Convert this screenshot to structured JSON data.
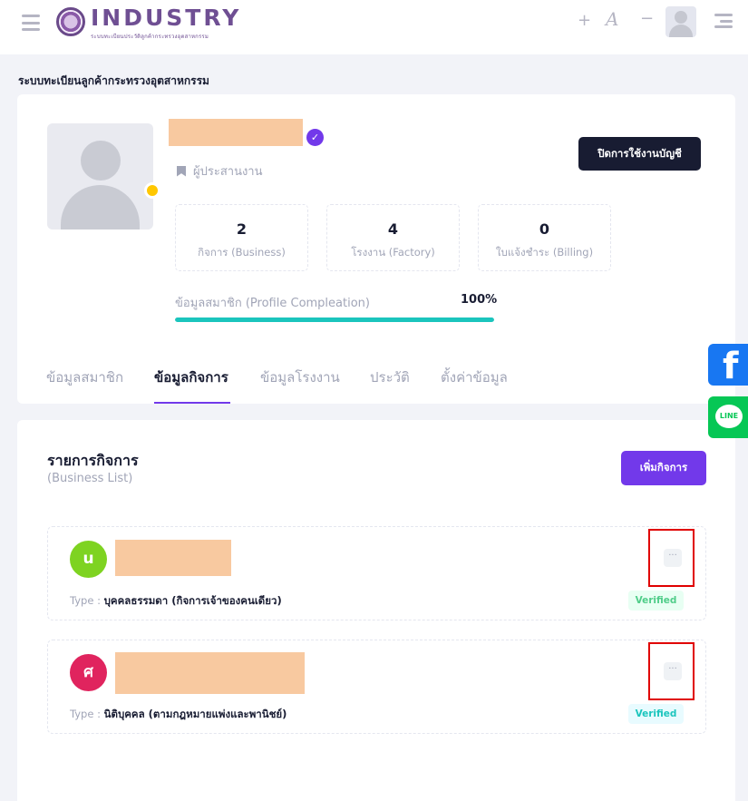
{
  "header": {
    "logo_word": "INDUSTRY",
    "logo_sub": "ระบบทะเบียนประวัติลูกค้ากระทรวงอุตสาหกรรม",
    "font_increase": "+",
    "font_label": "A",
    "font_decrease": "−"
  },
  "page_title": "ระบบทะเบียนลูกค้ากระทรวงอุตสาหกรรม",
  "profile": {
    "role": "ผู้ประสานงาน",
    "deactivate_button": "ปิดการใช้งานบัญชี",
    "stats": [
      {
        "value": "2",
        "label": "กิจการ (Business)"
      },
      {
        "value": "4",
        "label": "โรงงาน (Factory)"
      },
      {
        "value": "0",
        "label": "ใบแจ้งชำระ (Billing)"
      }
    ],
    "progress_label": "ข้อมูลสมาชิก (Profile Compleation)",
    "progress_text": "100%",
    "progress_value": 1.0,
    "status_color": "#ffc700",
    "verified_icon": "check-badge-icon"
  },
  "tabs": [
    {
      "label": "ข้อมูลสมาชิก",
      "active": false
    },
    {
      "label": "ข้อมูลกิจการ",
      "active": true
    },
    {
      "label": "ข้อมูลโรงงาน",
      "active": false
    },
    {
      "label": "ประวัติ",
      "active": false
    },
    {
      "label": "ตั้งค่าข้อมูล",
      "active": false
    }
  ],
  "business": {
    "title": "รายการกิจการ",
    "subtitle": "(Business List)",
    "add_button": "เพิ่มกิจการ",
    "items": [
      {
        "initial": "u",
        "avatar_color": "#7ed321",
        "type_key": "Type : ",
        "type_value": "บุคคลธรรมดา (กิจการเจ้าของคนเดียว)",
        "more": "···",
        "status": "Verified"
      },
      {
        "initial": "ศ",
        "avatar_color": "#e0245e",
        "type_key": "Type : ",
        "type_value": "นิติบุคคล (ตามกฎหมายแพ่งและพานิชย์)",
        "more": "···",
        "status": "Verified"
      }
    ]
  },
  "social": {
    "facebook_glyph": "f",
    "line_glyph": "LINE",
    "facebook_color": "#1877f2",
    "line_color": "#06c755"
  },
  "colors": {
    "accent": "#7239ea",
    "dark_button": "#181c32",
    "progress": "#1bc5bd"
  }
}
